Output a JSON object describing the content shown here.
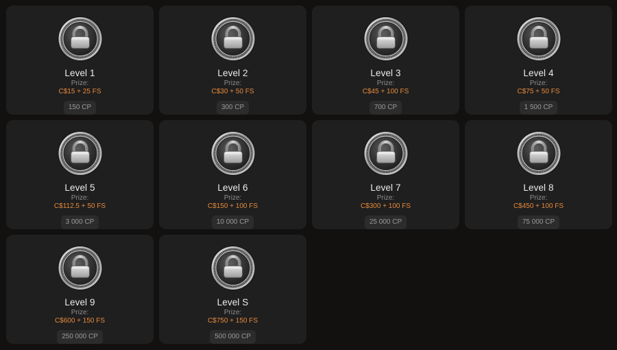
{
  "colors": {
    "page_background": "#121110",
    "card_background": "#1f1f1f",
    "prize_accent": "#e68a3c",
    "points_pill": "#2c2c2c"
  },
  "levels": [
    {
      "title": "Level 1",
      "prize_label": "Prize:",
      "prize": "C$15 + 25 FS",
      "points": "150 CP",
      "icon": "locked-coin-icon"
    },
    {
      "title": "Level 2",
      "prize_label": "Prize:",
      "prize": "C$30 + 50 FS",
      "points": "300 CP",
      "icon": "locked-coin-icon"
    },
    {
      "title": "Level 3",
      "prize_label": "Prize:",
      "prize": "C$45 + 100 FS",
      "points": "700 CP",
      "icon": "locked-coin-icon"
    },
    {
      "title": "Level 4",
      "prize_label": "Prize:",
      "prize": "C$75 + 50 FS",
      "points": "1 500 CP",
      "icon": "locked-coin-icon"
    },
    {
      "title": "Level 5",
      "prize_label": "Prize:",
      "prize": "C$112.5 + 50 FS",
      "points": "3 000 CP",
      "icon": "locked-coin-icon"
    },
    {
      "title": "Level 6",
      "prize_label": "Prize:",
      "prize": "C$150 + 100 FS",
      "points": "10 000 CP",
      "icon": "locked-coin-icon"
    },
    {
      "title": "Level 7",
      "prize_label": "Prize:",
      "prize": "C$300 + 100 FS",
      "points": "25 000 CP",
      "icon": "locked-coin-icon"
    },
    {
      "title": "Level 8",
      "prize_label": "Prize:",
      "prize": "C$450 + 100 FS",
      "points": "75 000 CP",
      "icon": "locked-coin-icon"
    },
    {
      "title": "Level 9",
      "prize_label": "Prize:",
      "prize": "C$600 + 150 FS",
      "points": "250 000 CP",
      "icon": "locked-coin-icon"
    },
    {
      "title": "Level S",
      "prize_label": "Prize:",
      "prize": "C$750 + 150 FS",
      "points": "500 000 CP",
      "icon": "locked-coin-icon"
    }
  ]
}
